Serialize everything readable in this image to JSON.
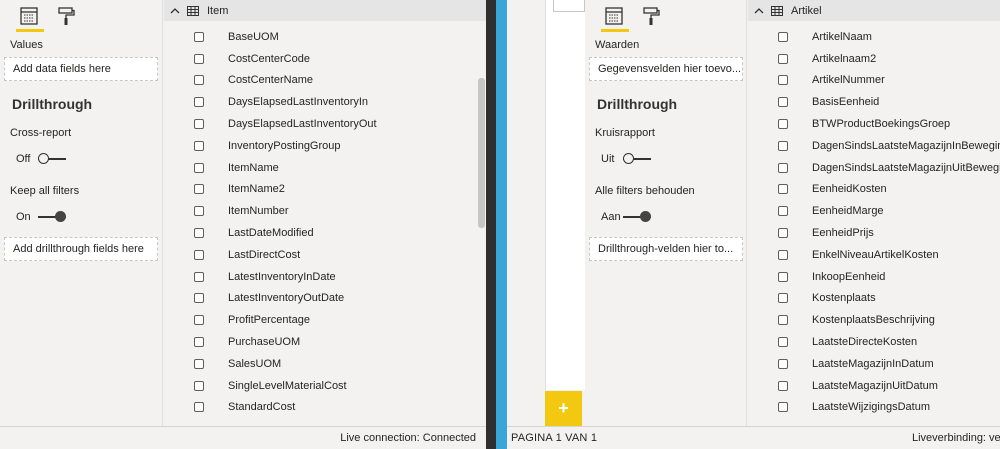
{
  "left": {
    "table_name": "Item",
    "values_label": "Values",
    "values_placeholder": "Add data fields here",
    "drillthrough_title": "Drillthrough",
    "cross_report_label": "Cross-report",
    "cross_report_state": "Off",
    "keep_filters_label": "Keep all filters",
    "keep_filters_state": "On",
    "drill_placeholder": "Add drillthrough fields here",
    "fields": [
      "BaseUOM",
      "CostCenterCode",
      "CostCenterName",
      "DaysElapsedLastInventoryIn",
      "DaysElapsedLastInventoryOut",
      "InventoryPostingGroup",
      "ItemName",
      "ItemName2",
      "ItemNumber",
      "LastDateModified",
      "LastDirectCost",
      "LatestInventoryInDate",
      "LatestInventoryOutDate",
      "ProfitPercentage",
      "PurchaseUOM",
      "SalesUOM",
      "SingleLevelMaterialCost",
      "StandardCost"
    ],
    "status": "Live connection: Connected"
  },
  "right": {
    "table_name": "Artikel",
    "values_label": "Waarden",
    "values_placeholder": "Gegevensvelden hier toevo...",
    "drillthrough_title": "Drillthrough",
    "cross_report_label": "Kruisrapport",
    "cross_report_state": "Uit",
    "keep_filters_label": "Alle filters behouden",
    "keep_filters_state": "Aan",
    "drill_placeholder": "Drillthrough-velden hier to...",
    "fields": [
      "ArtikelNaam",
      "Artikelnaam2",
      "ArtikelNummer",
      "BasisEenheid",
      "BTWProductBoekingsGroep",
      "DagenSindsLaatsteMagazijnInBeweging",
      "DagenSindsLaatsteMagazijnUitBeweging",
      "EenheidKosten",
      "EenheidMarge",
      "EenheidPrijs",
      "EnkelNiveauArtikelKosten",
      "InkoopEenheid",
      "Kostenplaats",
      "KostenplaatsBeschrijving",
      "LaatsteDirecteKosten",
      "LaatsteMagazijnInDatum",
      "LaatsteMagazijnUitDatum",
      "LaatsteWijzigingsDatum"
    ],
    "page_label": "PAGINA 1 VAN 1",
    "add_page": "+",
    "status": "Liveverbinding: verb"
  },
  "colors": {
    "accent": "#f2c811",
    "divider_blue": "#3aa5d8"
  },
  "icons": [
    "fields-icon",
    "format-paint-roller-icon",
    "chevron-up-icon",
    "table-icon",
    "checkbox-icon",
    "add-page-icon"
  ]
}
